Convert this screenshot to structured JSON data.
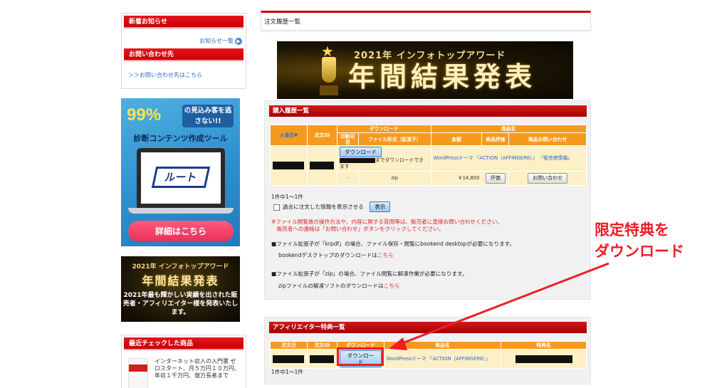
{
  "sidebar": {
    "news_heading": "新着お知らせ",
    "news_link": "お知らせ一覧",
    "contact_heading": "お問い合わせ先",
    "contact_link": "＞＞お問い合わせ先はこちら",
    "route_banner": {
      "percent": "99%",
      "bubble": "の見込み客を逃さない!!",
      "title": "診断コンテンツ作成ツール",
      "logo": "ルート",
      "button": "詳細はこちら"
    },
    "award_banner": {
      "line1": "2021年 インフォトップアワード",
      "line2": "年間結果発表",
      "line3": "2021年最も輝かしい実績を出された販売者・アフィリエイター様を発表いたします。"
    },
    "recent_heading": "最近チェックした商品",
    "recent_item_text": "インターネット収入の入門書 ゼロスタート、月５万円１０万円、年収１千万円、億万長者まで"
  },
  "main": {
    "page_title": "注文履歴一覧",
    "top_banner": {
      "line1": "2021年 インフォトップアワード",
      "line2": "年間結果発表"
    },
    "purchase": {
      "title": "購入履歴一覧",
      "head_download_group": "ダウンロード",
      "head_product_group": "商品名",
      "head_date": "入金日▼",
      "head_order_id": "注文ID",
      "head_print": "印刷可否",
      "head_format": "ファイル形式（拡張子）",
      "head_price": "金額",
      "head_review": "商品評価",
      "head_inquiry": "商品お問い合わせ",
      "download_button": "ダウンロード",
      "download_note": "までダウンロードできます",
      "product_link": "WordPressテーマ 『ACTION（AFFINGER6）』",
      "seller_info": "『販売者情報』",
      "print_value": "-",
      "format_value": "zip",
      "price_value": "￥14,800",
      "review_button": "評価",
      "inquiry_button": "お問い合わせ",
      "count_text": "1件中1〜1件",
      "show_past_label": "過去に注文した情報を表示させる",
      "show_button": "表示",
      "notice1": "※ファイル閲覧後の操作方法や、内容に関する質問等は、販売者に直接お問い合わせください。",
      "notice2": "　販売者への連絡は「お問い合わせ」ボタンをクリックしてください。",
      "krpdf_text": "■ファイル拡張子が「krpdf」の場合、ファイル保存・閲覧にbookend desktopが必要になります。",
      "bookend_text": "bookendデスクトップのダウンロードは",
      "here_link1": "こちら",
      "zip_text": "■ファイル拡張子が「zip」の場合、ファイル閲覧に解凍作業が必要になります。",
      "zip_soft_text": "zipファイルの解凍ソフトのダウンロードは",
      "here_link2": "こちら"
    },
    "affiliate": {
      "title": "アフィリエイター特典一覧",
      "head_date": "注文日",
      "head_order_id": "注文ID",
      "head_download": "ダウンロード",
      "head_product": "商品名",
      "head_bonus": "特典名",
      "download_button": "ダウンロード",
      "product_link": "WordPressテーマ 『ACTION（AFFINGER6）』",
      "count_text": "1件中1〜1件"
    }
  },
  "annotation": {
    "line1": "限定特典を",
    "line2": "ダウンロード",
    "color": "#ee1c25"
  }
}
